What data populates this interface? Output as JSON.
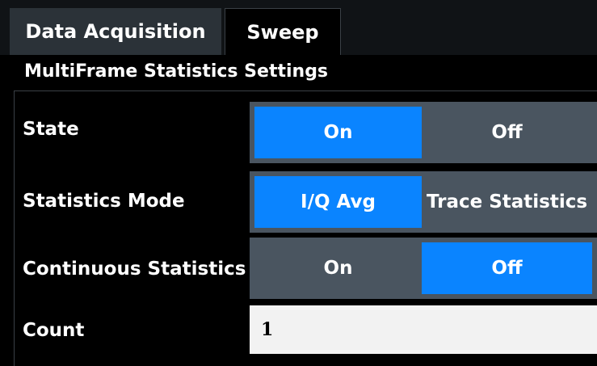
{
  "tabs": {
    "data_acquisition": "Data Acquisition",
    "sweep": "Sweep"
  },
  "section": {
    "title": "MultiFrame Statistics Settings"
  },
  "state": {
    "label": "State",
    "on": "On",
    "off": "Off",
    "selected": "On"
  },
  "statistics_mode": {
    "label": "Statistics Mode",
    "iq_avg": "I/Q Avg",
    "trace_statistics": "Trace Statistics",
    "selected": "I/Q Avg"
  },
  "continuous_statistics": {
    "label": "Continuous Statistics",
    "on": "On",
    "off": "Off",
    "selected": "Off"
  },
  "count": {
    "label": "Count",
    "value": "1"
  },
  "colors": {
    "accent": "#0a84ff",
    "toggle_bg": "#4a5560",
    "field_bg": "#f2f2f2"
  }
}
